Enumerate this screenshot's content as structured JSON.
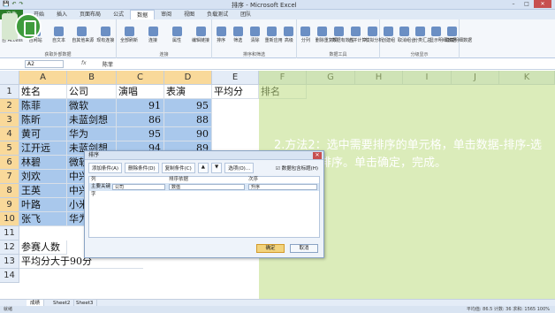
{
  "window": {
    "title": "排序 - Microsoft Excel",
    "qat": [
      "💾",
      "↶",
      "↷"
    ]
  },
  "ribbon_tabs": [
    "文件",
    "开始",
    "插入",
    "页面布局",
    "公式",
    "数据",
    "审阅",
    "视图",
    "负载测试",
    "团队"
  ],
  "active_tab_index": 5,
  "ribbon": {
    "groups": [
      {
        "caption": "获取外部数据",
        "buttons": [
          "自 Access",
          "自网站",
          "自文本",
          "自其他来源",
          "现有连接"
        ]
      },
      {
        "caption": "连接",
        "buttons": [
          "全部刷新",
          "连接",
          "属性",
          "编辑链接"
        ]
      },
      {
        "caption": "排序和筛选",
        "buttons": [
          "排序",
          "筛选",
          "清除",
          "重新应用",
          "高级"
        ]
      },
      {
        "caption": "数据工具",
        "buttons": [
          "分列",
          "删除重复项",
          "数据有效性",
          "合并计算",
          "模拟分析"
        ]
      },
      {
        "caption": "分级显示",
        "buttons": [
          "创建组",
          "取消组合",
          "分类汇总",
          "显示明细数据",
          "隐藏明细数据"
        ]
      }
    ]
  },
  "formula_bar": {
    "name_box": "A2",
    "fx": "fx",
    "value": "陈菲"
  },
  "columns": [
    "A",
    "B",
    "C",
    "D",
    "E",
    "F",
    "G",
    "H",
    "I",
    "J",
    "K"
  ],
  "selected_columns": [
    "A",
    "B",
    "C",
    "D"
  ],
  "rows": [
    "1",
    "2",
    "3",
    "4",
    "5",
    "6",
    "7",
    "8",
    "9",
    "10",
    "11",
    "12",
    "13",
    "14"
  ],
  "table": {
    "header": [
      "姓名",
      "公司",
      "演唱",
      "表演",
      "平均分",
      "排名"
    ],
    "data": [
      [
        "陈菲",
        "微软",
        "91",
        "95"
      ],
      [
        "陈昕",
        "未蓝剑想",
        "86",
        "88"
      ],
      [
        "黄可",
        "华为",
        "95",
        "90"
      ],
      [
        "江开远",
        "未蓝剑想",
        "94",
        "89"
      ],
      [
        "林碧",
        "微软",
        "",
        ""
      ],
      [
        "刘欢",
        "中兴",
        "",
        ""
      ],
      [
        "王英",
        "中兴",
        "",
        ""
      ],
      [
        "叶路",
        "小米",
        "",
        ""
      ],
      [
        "张飞",
        "华为",
        "",
        ""
      ]
    ],
    "row12": "参赛人数",
    "row13": "平均分大于90分"
  },
  "overlay_text": "2.方法2：选中需要排序的单元格，单击数据-排序-选择关键字排序。单击确定，完成。",
  "sort_dialog": {
    "title": "排序",
    "toolbar": [
      "添加条件(A)",
      "删除条件(D)",
      "复制条件(C)",
      "▲",
      "▼",
      "选项(O)..."
    ],
    "checkbox": "数据包含标题(H)",
    "columns": [
      "列",
      "排序依据",
      "次序"
    ],
    "row": {
      "label": "主要关键字",
      "key": "公司",
      "basis": "数值",
      "order": "升序"
    },
    "ok": "确定",
    "cancel": "取消"
  },
  "sheet_tabs": [
    "成绩",
    "Sheet2",
    "Sheet3"
  ],
  "status": {
    "left": "就绪",
    "right": "平均值: 86.5   计数: 36   求和: 1565     100%"
  }
}
